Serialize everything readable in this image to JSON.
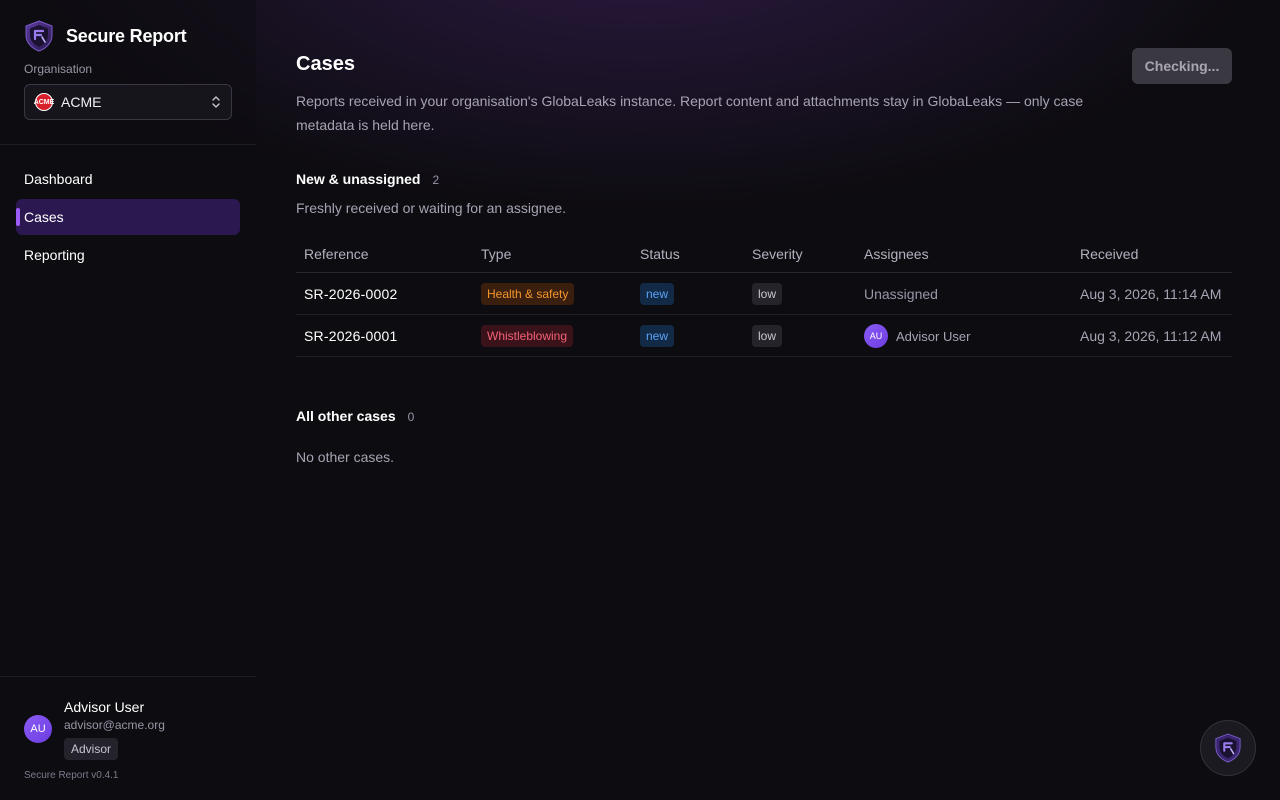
{
  "app": {
    "name": "Secure Report",
    "version": "Secure Report v0.4.1"
  },
  "org": {
    "label": "Organisation",
    "selected": "ACME",
    "icon_text": "ACME"
  },
  "nav": {
    "items": [
      {
        "label": "Dashboard",
        "active": false
      },
      {
        "label": "Cases",
        "active": true
      },
      {
        "label": "Reporting",
        "active": false
      }
    ]
  },
  "user": {
    "initials": "AU",
    "name": "Advisor User",
    "email": "advisor@acme.org",
    "role": "Advisor"
  },
  "page": {
    "title": "Cases",
    "description": "Reports received in your organisation's GlobaLeaks instance. Report content and attachments stay in GlobaLeaks — only case metadata is held here.",
    "status_button": "Checking..."
  },
  "sections": {
    "new": {
      "title": "New & unassigned",
      "count": "2",
      "description": "Freshly received or waiting for an assignee."
    },
    "other": {
      "title": "All other cases",
      "count": "0",
      "empty": "No other cases."
    }
  },
  "table": {
    "columns": [
      "Reference",
      "Type",
      "Status",
      "Severity",
      "Assignees",
      "Received"
    ],
    "rows": [
      {
        "reference": "SR-2026-0002",
        "type": "Health & safety",
        "status": "new",
        "severity": "low",
        "assignee": "Unassigned",
        "assignee_initials": "",
        "received": "Aug 3, 2026, 11:14 AM"
      },
      {
        "reference": "SR-2026-0001",
        "type": "Whistleblowing",
        "status": "new",
        "severity": "low",
        "assignee": "Advisor User",
        "assignee_initials": "AU",
        "received": "Aug 3, 2026, 11:12 AM"
      }
    ]
  },
  "colors": {
    "accent": "#9b5cf6",
    "active_nav_bg": "#2c1850",
    "type_health_safety": "#f5962a",
    "type_whistleblowing": "#f46177",
    "status_new": "#5aa2f5"
  },
  "icons": {
    "brand": "shield-logo-icon",
    "org": "acme-logo-icon",
    "select": "chevron-up-down-icon",
    "fab": "shield-logo-icon"
  }
}
